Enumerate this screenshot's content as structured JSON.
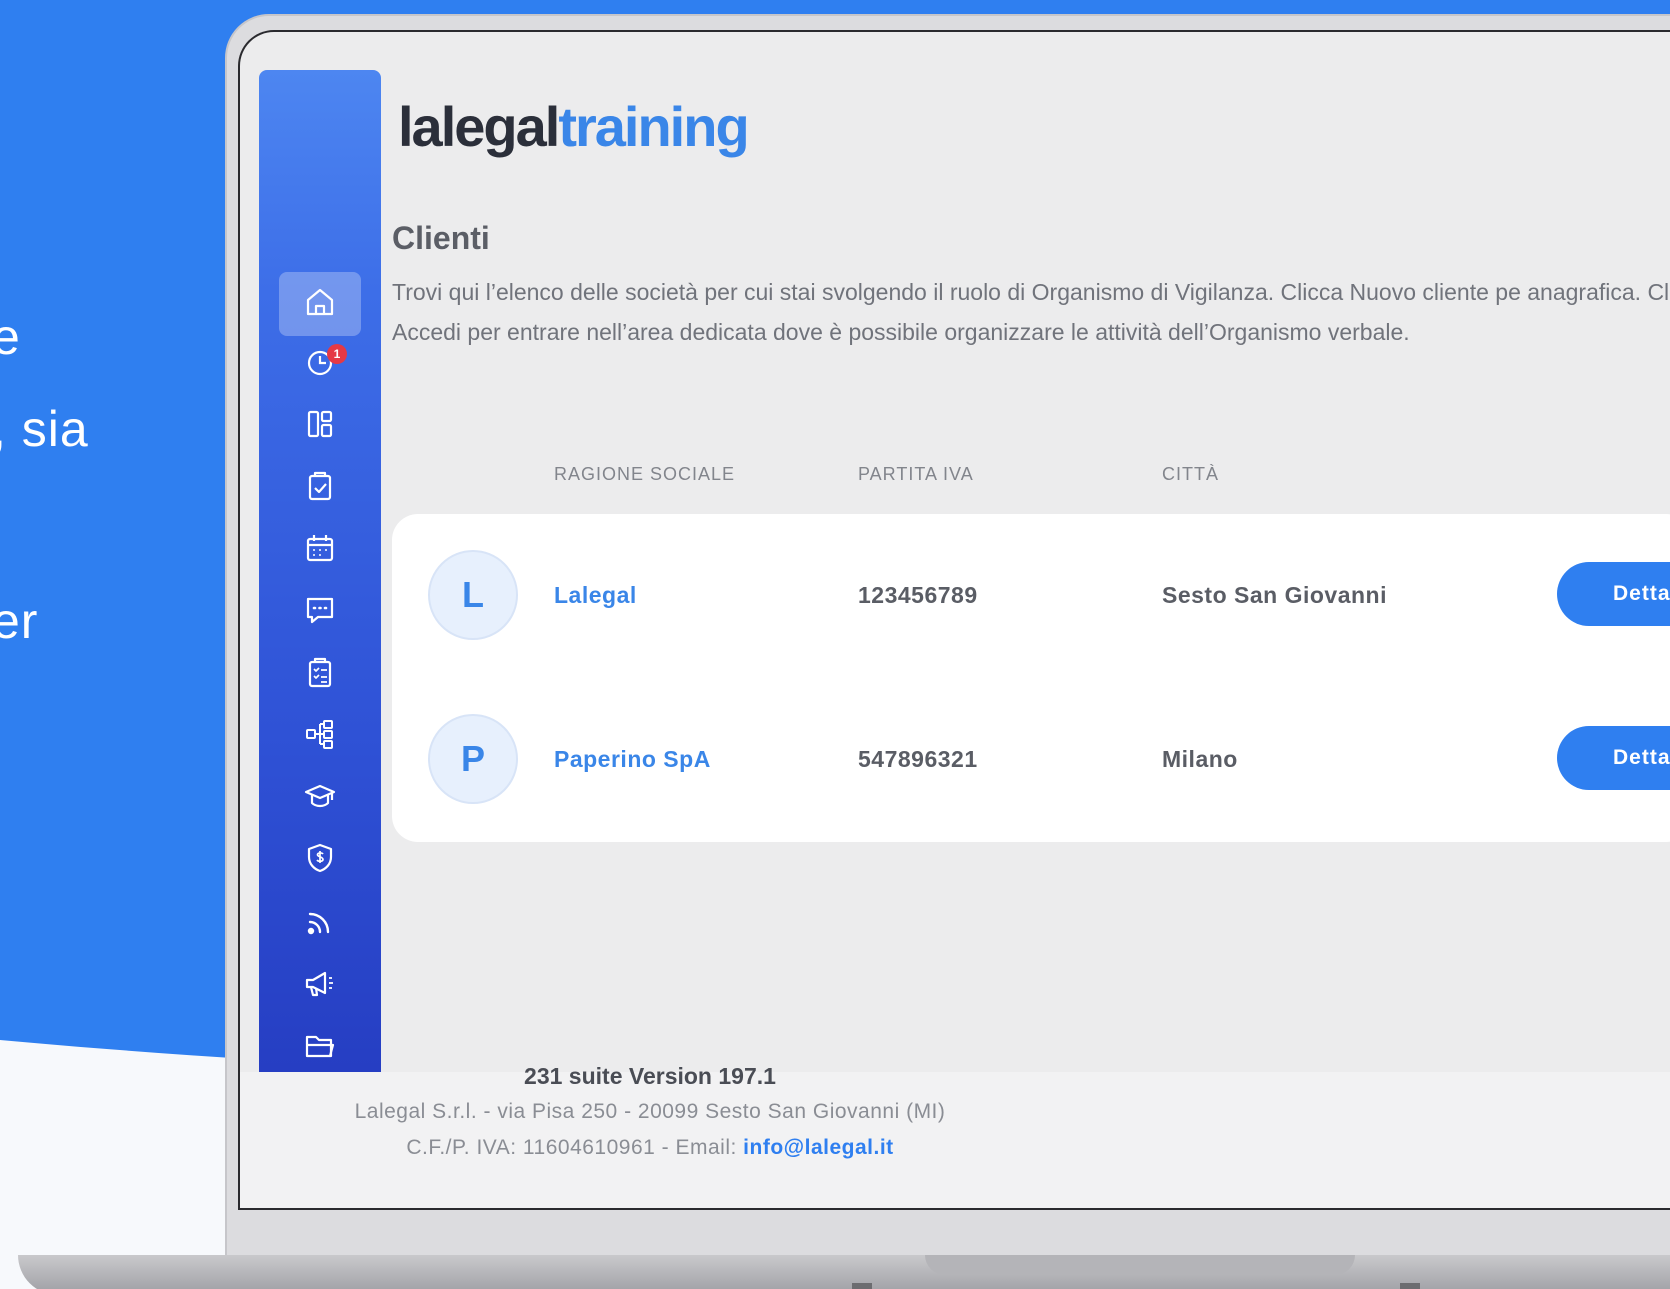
{
  "marketing": {
    "line1": "e",
    "line2": ", sia",
    "line3": "er"
  },
  "colors": {
    "brand_blue": "#3a86e8",
    "button_blue": "#2f7ff0",
    "sidebar_top": "#4d86f1",
    "sidebar_bottom": "#2338bd",
    "badge_red": "#e53945"
  },
  "logo": {
    "part1": "lalegal",
    "part2": "training"
  },
  "sidebar": {
    "items": [
      {
        "icon": "home-icon",
        "active": true
      },
      {
        "icon": "clock-icon",
        "badge": "1"
      },
      {
        "icon": "dashboard-icon"
      },
      {
        "icon": "clipboard-check-icon"
      },
      {
        "icon": "calendar-icon"
      },
      {
        "icon": "chat-icon"
      },
      {
        "icon": "checklist-icon"
      },
      {
        "icon": "org-chart-icon"
      },
      {
        "icon": "graduation-cap-icon"
      },
      {
        "icon": "shield-dollar-icon"
      },
      {
        "icon": "rss-icon"
      },
      {
        "icon": "megaphone-icon"
      },
      {
        "icon": "folder-icon"
      }
    ]
  },
  "page": {
    "title": "Clienti",
    "description": "Trovi qui l’elenco delle società per cui stai svolgendo il ruolo di Organismo di Vigilanza. Clicca Nuovo cliente pe anagrafica. Clicca Accedi per entrare nell’area dedicata dove è possibile organizzare le attività dell’Organismo verbale."
  },
  "table": {
    "headers": [
      "RAGIONE SOCIALE",
      "PARTITA IVA",
      "CITTÀ"
    ],
    "rows": [
      {
        "initial": "L",
        "name": "Lalegal",
        "vat": "123456789",
        "city": "Sesto San Giovanni",
        "action": "Detta"
      },
      {
        "initial": "P",
        "name": "Paperino SpA",
        "vat": "547896321",
        "city": "Milano",
        "action": "Detta"
      }
    ]
  },
  "footer": {
    "version": "231 suite Version 197.1",
    "address": "Lalegal S.r.l. - via Pisa 250 - 20099 Sesto San Giovanni (MI)",
    "fiscal_prefix": "C.F./P. IVA: 11604610961 - Email: ",
    "email": "info@lalegal.it"
  }
}
